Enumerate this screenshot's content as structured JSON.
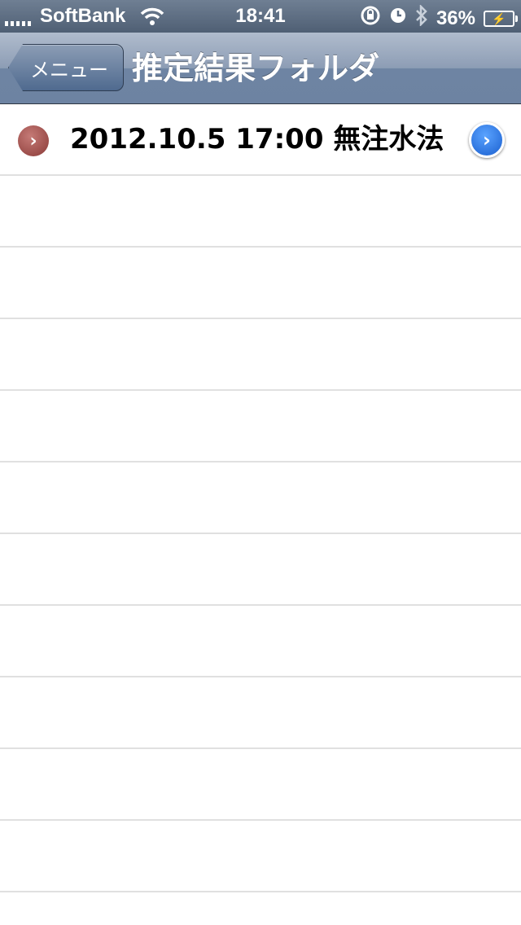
{
  "status_bar": {
    "carrier": "SoftBank",
    "time": "18:41",
    "battery": "36%",
    "icons": [
      "signal-icon",
      "wifi-icon",
      "orientation-lock-icon",
      "alarm-icon",
      "bluetooth-icon",
      "battery-icon"
    ]
  },
  "nav": {
    "back_label": "メニュー",
    "title": "推定結果フォルダ"
  },
  "list": {
    "items": [
      {
        "label": "2012.10.5 17:00 無注水法",
        "icon": "arrow-right-icon",
        "accessory": "detail-disclosure-icon"
      }
    ],
    "empty_rows": 10
  },
  "colors": {
    "nav_bar": "#8d9db5",
    "status_bar": "#5a6a80",
    "row_icon": "#a04e4a",
    "disclosure": "#2a7be8",
    "separator": "#e0e0e0"
  }
}
